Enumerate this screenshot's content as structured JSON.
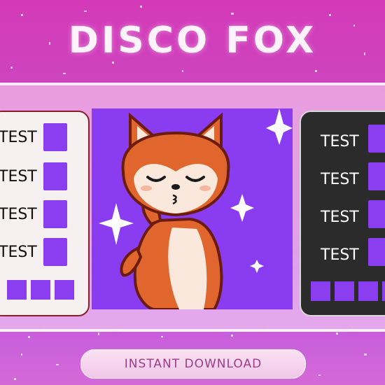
{
  "header": {
    "title": "DISCO FOX"
  },
  "left_panel": {
    "rows": [
      "TEST",
      "TEST",
      "TEST",
      "TEST"
    ]
  },
  "right_panel": {
    "rows": [
      "TEST",
      "TEST",
      "TEST",
      "TEST"
    ]
  },
  "cta": {
    "label": "INSTANT DOWNLOAD"
  },
  "colors": {
    "background": "#c84cc4",
    "emote_bg": "#8a3cf0",
    "fox_orange": "#e0662e",
    "dark_panel": "#2b2b2b",
    "light_panel": "#f6f0f0"
  }
}
